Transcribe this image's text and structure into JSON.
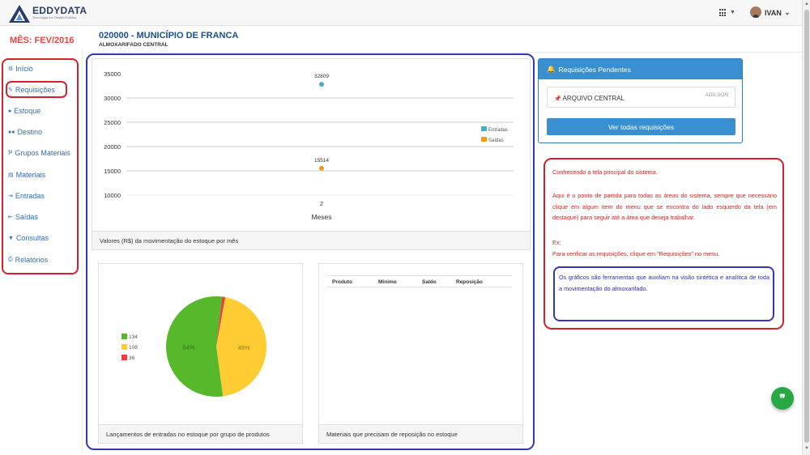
{
  "brand": {
    "name": "EDDYDATA",
    "tagline": "Tecnologia em Gestão Pública"
  },
  "topbar": {
    "user": "IVAN"
  },
  "month_label": "MÊS: FEV/2016",
  "sidebar": {
    "items": [
      {
        "label": "Início",
        "icon": "dashboard-icon",
        "glyph": "⚙"
      },
      {
        "label": "Requisições",
        "icon": "edit-icon",
        "glyph": "✎"
      },
      {
        "label": "Estoque",
        "icon": "user-icon",
        "glyph": "●"
      },
      {
        "label": "Destino",
        "icon": "users-icon",
        "glyph": "●●"
      },
      {
        "label": "Grupos Materiais",
        "icon": "tree-icon",
        "glyph": "Ῥ"
      },
      {
        "label": "Materiais",
        "icon": "list-icon",
        "glyph": "▤"
      },
      {
        "label": "Entradas",
        "icon": "sign-in-icon",
        "glyph": "⇥"
      },
      {
        "label": "Saídas",
        "icon": "sign-out-icon",
        "glyph": "⇤"
      },
      {
        "label": "Consultas",
        "icon": "filter-icon",
        "glyph": "▼"
      },
      {
        "label": "Relatórios",
        "icon": "print-icon",
        "glyph": "⎙"
      }
    ]
  },
  "header": {
    "title": "020000 - MUNICÍPIO DE FRANCA",
    "subtitle": "ALMOXARIFADO CENTRAL"
  },
  "chart_main": {
    "footer": "Valores (R$) da movimentação do estoque por mês"
  },
  "chart_pie": {
    "footer": "Lançamentos de entradas no estoque por grupo de produtos"
  },
  "table": {
    "headers": [
      "Produto",
      "Mínimo",
      "Saldo",
      "Reposição"
    ],
    "footer": "Materiais que precisam de reposição no estoque"
  },
  "pending": {
    "title": "Requisições Pendentes",
    "item_name": "ARQUIVO CENTRAL",
    "item_user": "ADILSON",
    "button": "Ver todas requisições"
  },
  "note": {
    "p1": "Conhecendo a tela principal do sistema.",
    "p2": "Aqui é o ponto de partida para todas as áreas do sistema, sempre que necessário clique em algum item do menu que se encontra do lado esquerdo da tela (em destaque) para seguir até a área que deseja trabalhar.",
    "p3": "Ex:",
    "p4": "Para verificar as requisições, clique em \"Requisições\" no menu.",
    "p5": "Os gráficos são ferramentas que auxiliam na visão sintética e analítica de toda a movimentação do almoxarifado."
  },
  "fab": {
    "glyph": "❞"
  },
  "colors": {
    "entradas": "#4bacc6",
    "saidas": "#f39c12",
    "pie_green": "#56b82a",
    "pie_yellow": "#ffcc33",
    "pie_red": "#e94040",
    "accent": "#3a8fd0"
  },
  "chart_data": [
    {
      "type": "scatter",
      "categories": [
        "2"
      ],
      "xlabel": "Meses",
      "ylabel": "",
      "ylim": [
        10000,
        35000
      ],
      "yticks": [
        35000,
        30000,
        25000,
        20000,
        15000,
        10000
      ],
      "legend": "right",
      "series": [
        {
          "name": "Entradas",
          "values": [
            32809
          ],
          "color": "#4bacc6"
        },
        {
          "name": "Saídas",
          "values": [
            15514
          ],
          "color": "#f39c12"
        }
      ]
    },
    {
      "type": "pie",
      "labels": [
        "134",
        "108",
        "36"
      ],
      "values": [
        54,
        45,
        1
      ],
      "slice_labels": [
        "54%",
        "45%",
        ""
      ],
      "colors": [
        "#56b82a",
        "#ffcc33",
        "#e94040"
      ],
      "legend": "left"
    }
  ]
}
